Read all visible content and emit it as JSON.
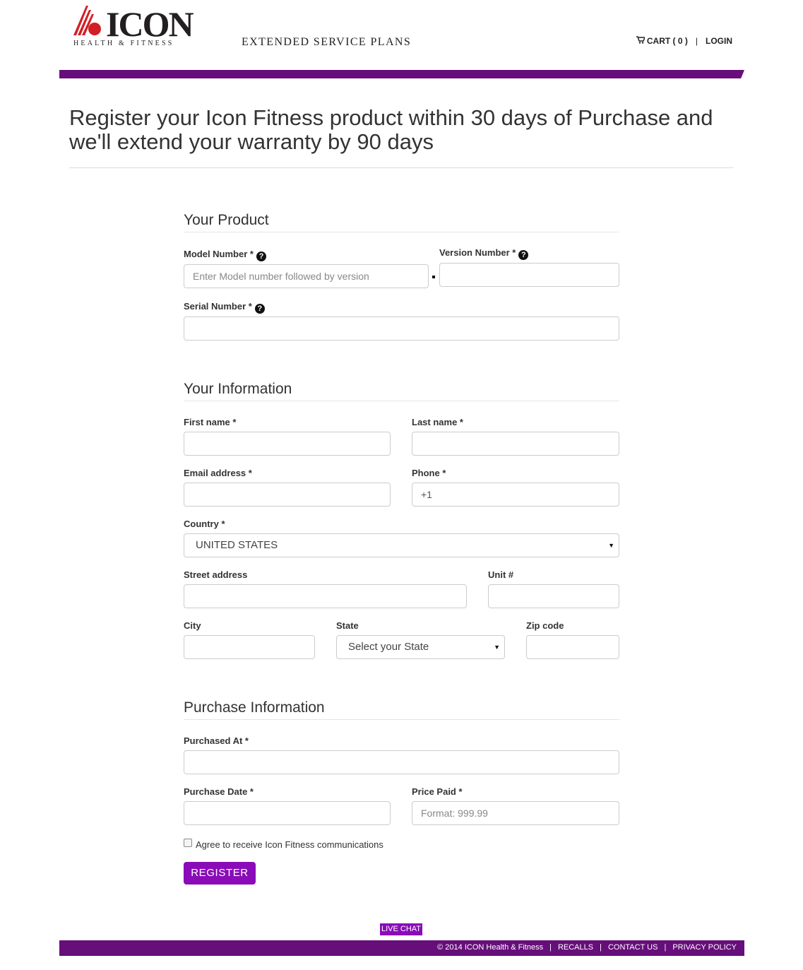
{
  "brand": {
    "logo_word": "ICON",
    "logo_sub": "HEALTH & FITNESS",
    "site_title": "EXTENDED SERVICE PLANS",
    "accent": "#660e7a",
    "button_color": "#8a0cb8"
  },
  "nav": {
    "cart": "CART ( 0 )",
    "separator": "|",
    "login": "LOGIN"
  },
  "headline": "Register your Icon Fitness product within 30 days of Purchase and we'll extend your warranty by 90 days",
  "product": {
    "title": "Your Product",
    "model_label": "Model Number *",
    "model_placeholder": "Enter Model number followed by version",
    "version_label": "Version Number *",
    "serial_label": "Serial Number *"
  },
  "info": {
    "title": "Your Information",
    "first_name": "First name *",
    "last_name": "Last name *",
    "email": "Email address *",
    "phone": "Phone *",
    "phone_value": "+1",
    "country": "Country *",
    "country_value": "UNITED STATES",
    "street": "Street address",
    "unit": "Unit #",
    "city": "City",
    "state": "State",
    "state_value": "Select your State",
    "zip": "Zip code"
  },
  "purchase": {
    "title": "Purchase Information",
    "purchased_at": "Purchased At *",
    "purchase_date": "Purchase Date *",
    "price_paid": "Price Paid *",
    "price_placeholder": "Format: 999.99"
  },
  "agree_label": "Agree to receive Icon Fitness communications",
  "register_label": "REGISTER",
  "live_chat": "LIVE CHAT",
  "footer": {
    "copyright": "© 2014 ICON Health & Fitness",
    "separator": "|",
    "recalls": "RECALLS",
    "contact": "CONTACT US",
    "privacy": "PRIVACY POLICY"
  }
}
